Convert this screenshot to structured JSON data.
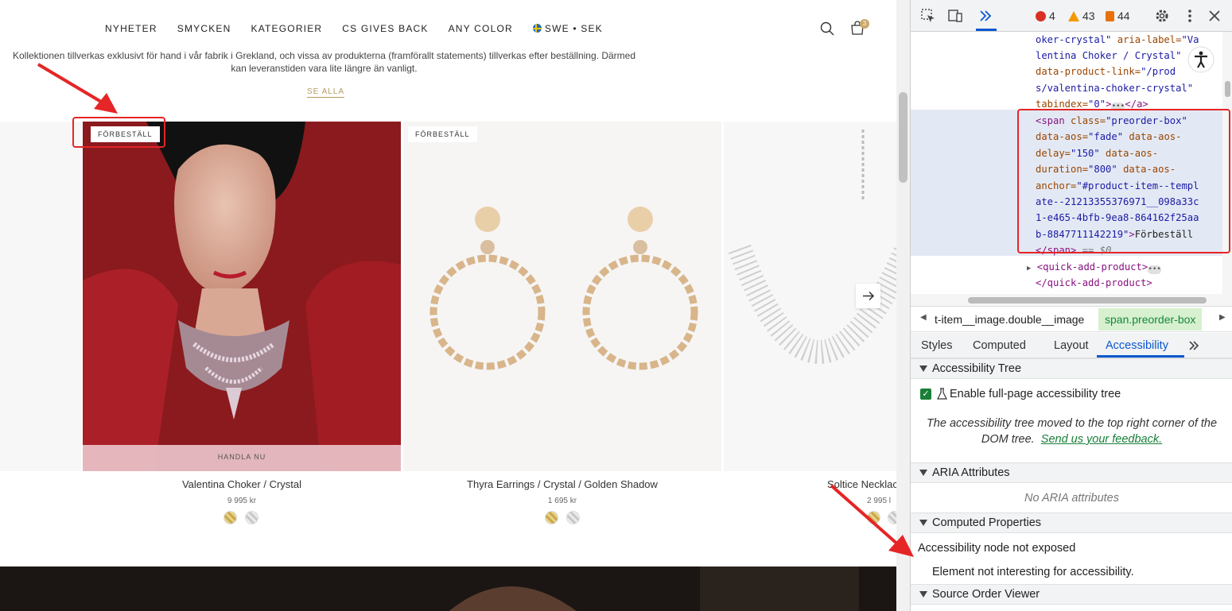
{
  "site": {
    "nav": [
      "NYHETER",
      "SMYCKEN",
      "KATEGORIER",
      "CS GIVES BACK",
      "ANY COLOR"
    ],
    "locale": "SWE • SEK",
    "cart_count": "3",
    "intro_line1": "Kollektionen tillverkas exklusivt för hand i vår fabrik i Grekland, och vissa av produkterna (framförallt statements) tillverkas efter beställning. Därmed",
    "intro_line2": "kan leveranstiden vara lite längre än vanligt.",
    "see_all": "SE ALLA",
    "preorder_label": "FÖRBESTÄLL",
    "shop_now": "HANDLA NU",
    "products": [
      {
        "name": "Valentina Choker / Crystal",
        "price": "9 995 kr"
      },
      {
        "name": "Thyra Earrings / Crystal / Golden Shadow",
        "price": "1 695 kr"
      },
      {
        "name": "Soltice Necklac",
        "price": "2 995 l"
      }
    ]
  },
  "devtools": {
    "errors": "4",
    "warnings": "43",
    "issues": "44",
    "dom_lines": {
      "l1_val": "oker-crystal\"",
      "l1_attr": " aria-label=",
      "l1_val2": "\"Va",
      "l2": "lentina Choker / Crystal\"",
      "l3_attr": "data-product-link=",
      "l3_val": "\"/prod",
      "l4": "s/valentina-choker-crystal\"",
      "l5_attr": "tabindex=",
      "l5_val": "\"0\"",
      "l5_end": "</a>",
      "s1_tag": "<span",
      "s1_attr": " class=",
      "s1_val": "\"preorder-box\"",
      "s2_attr": "data-aos=",
      "s2_val": "\"fade\"",
      "s2_attr2": " data-aos-",
      "s3_attr": "delay=",
      "s3_val": "\"150\"",
      "s3_attr2": " data-aos-",
      "s4_attr": "duration=",
      "s4_val": "\"800\"",
      "s4_attr2": " data-aos-",
      "s5_attr": "anchor=",
      "s5_val": "\"#product-item--templ",
      "s6": "ate--21213355376971__098a33c",
      "s7": "1-e465-4bfb-9ea8-864162f25aa",
      "s8_val": "b-8847711142219\"",
      "s8_txt": "Förbeställ",
      "s9_tag": "</span>",
      "s9_eq": " == $0",
      "q1": "<quick-add-product>",
      "q2": "</quick-add-product>"
    },
    "crumb1": "t-item__image.double__image",
    "crumb2": "span.preorder-box",
    "tabs": [
      "Styles",
      "Computed",
      "Layout",
      "Accessibility"
    ],
    "sections": {
      "tree": "Accessibility Tree",
      "enable": "Enable full-page accessibility tree",
      "moved1": "The accessibility tree moved to the top right corner of the",
      "moved2": "DOM tree.",
      "feedback": "Send us your feedback.",
      "aria": "ARIA Attributes",
      "no_aria": "No ARIA attributes",
      "computed": "Computed Properties",
      "not_exposed": "Accessibility node not exposed",
      "not_interesting": "Element not interesting for accessibility.",
      "source_order": "Source Order Viewer"
    }
  }
}
